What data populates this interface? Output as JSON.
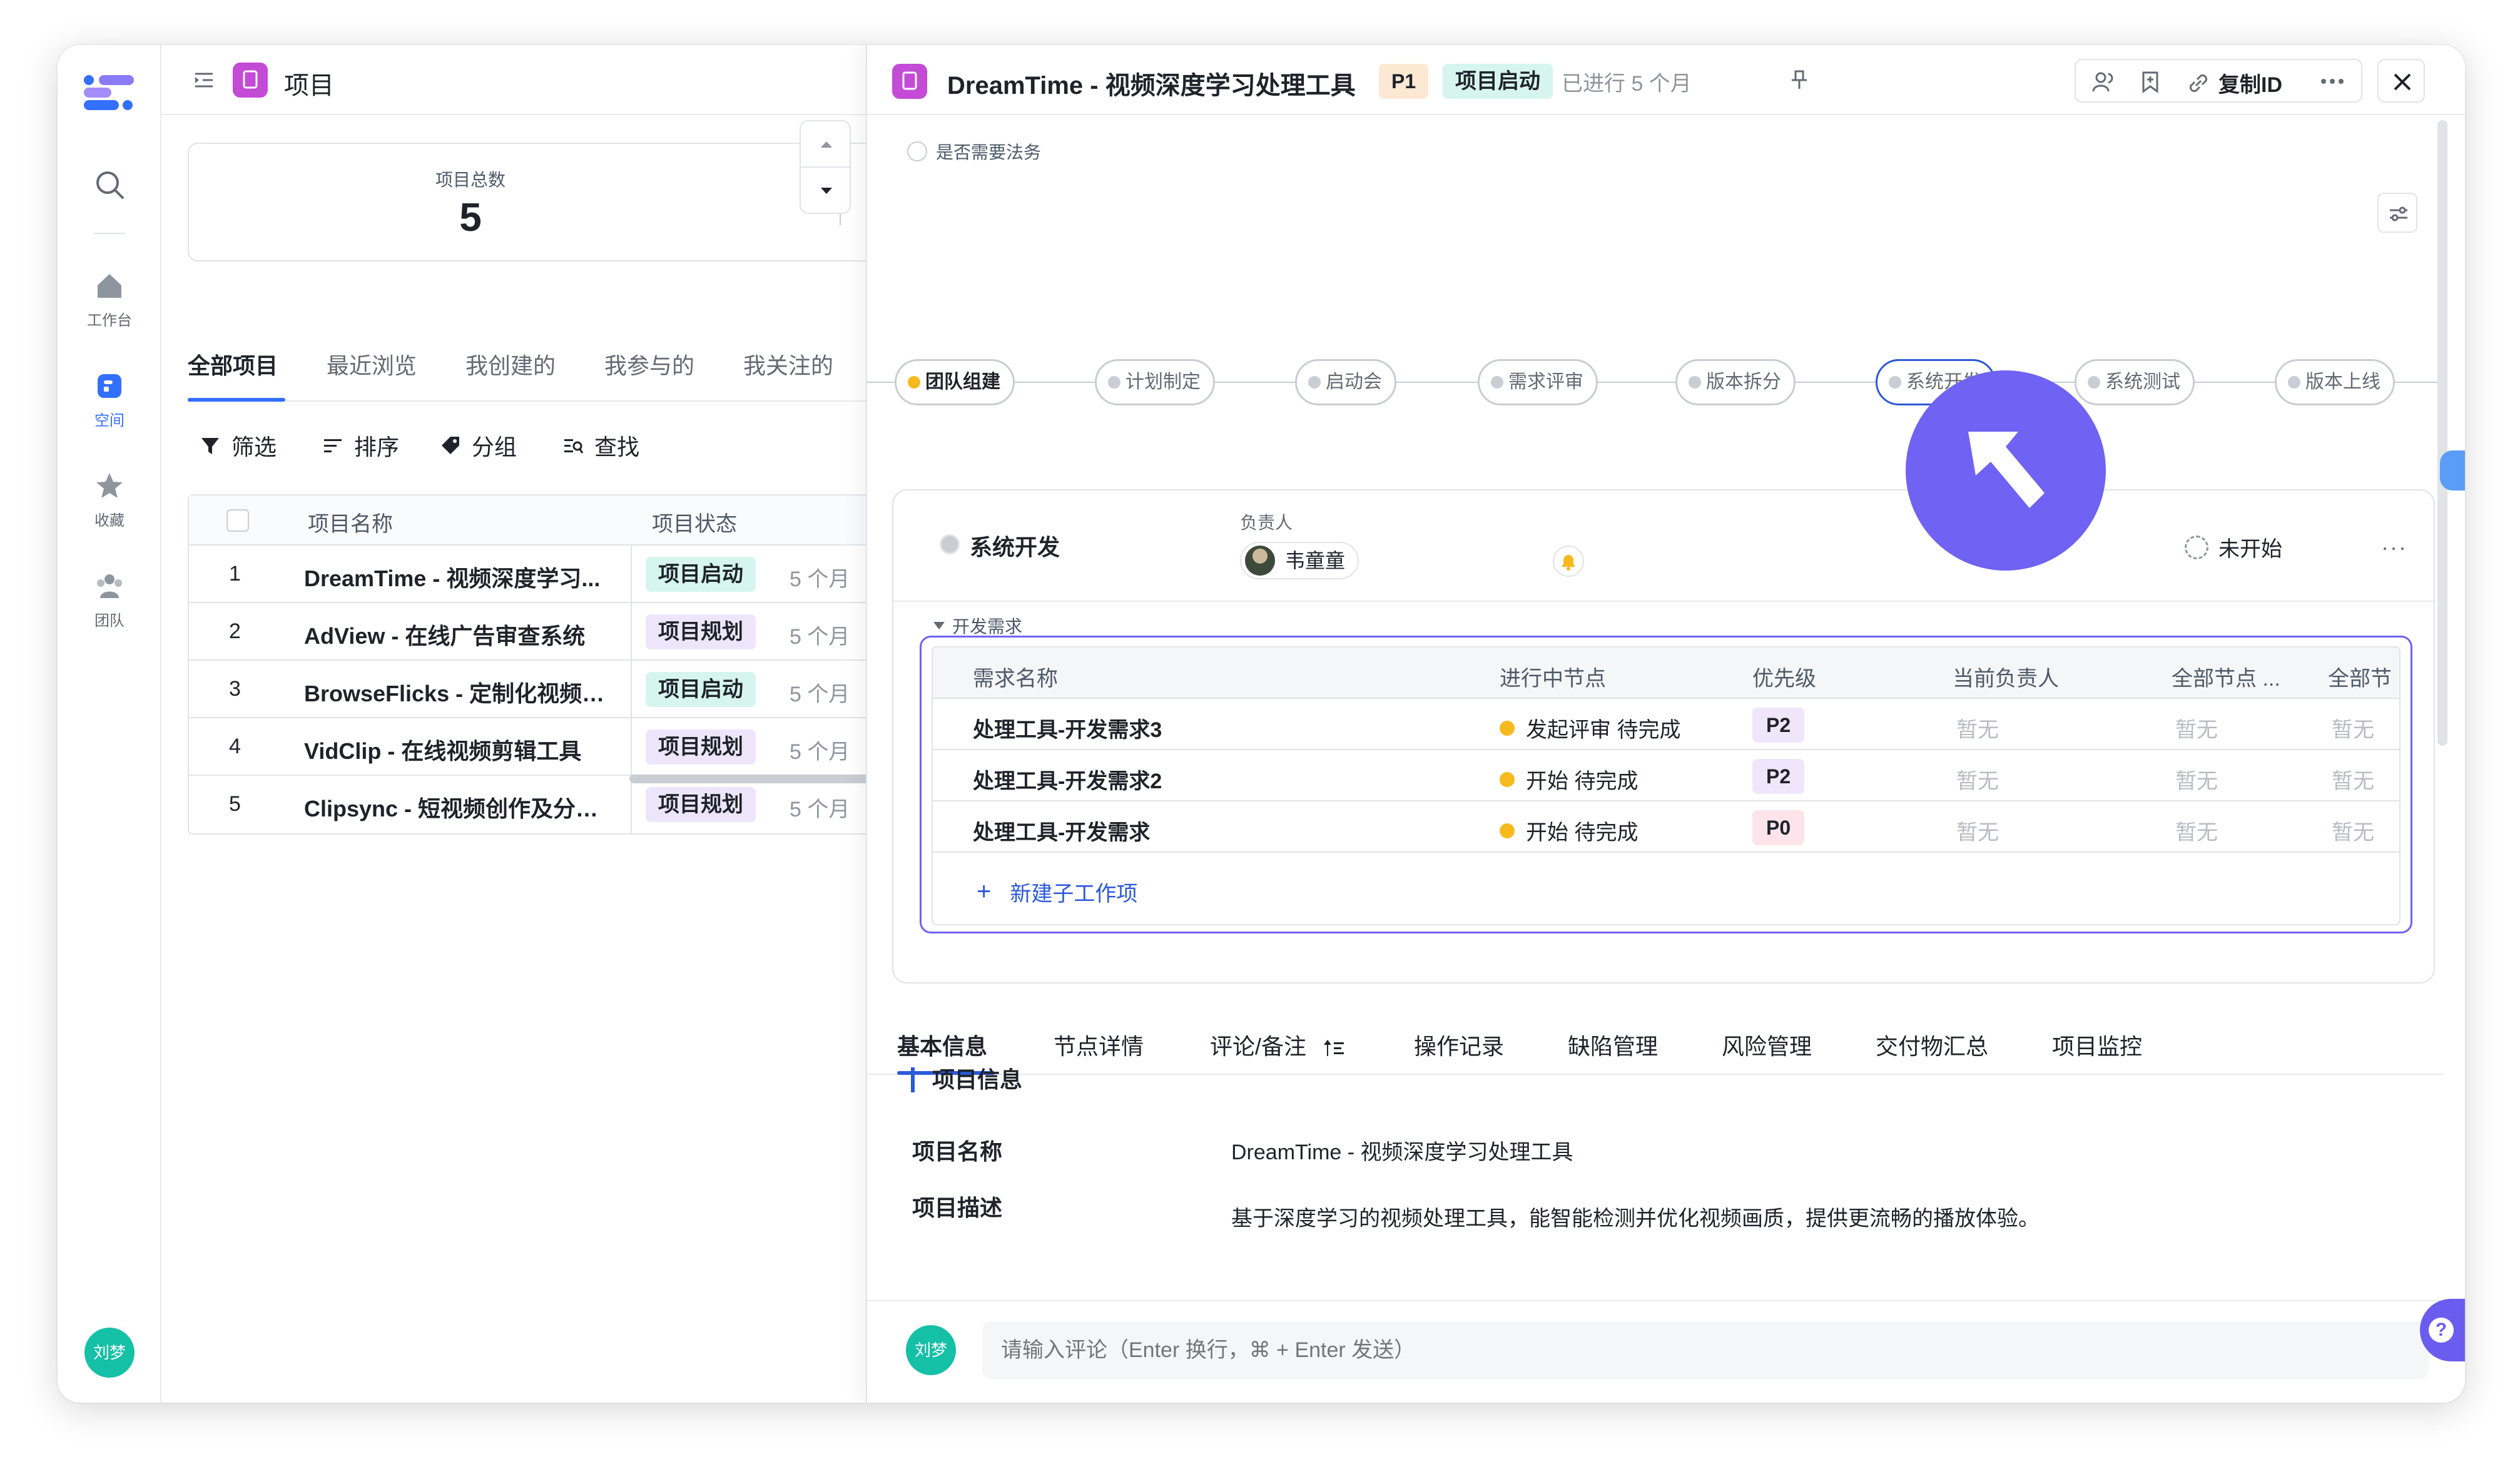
{
  "nav": {
    "items": [
      {
        "label": "工作台",
        "icon": "home-icon"
      },
      {
        "label": "空间",
        "icon": "space-icon",
        "active": true
      },
      {
        "label": "收藏",
        "icon": "star-icon"
      },
      {
        "label": "团队",
        "icon": "team-icon"
      }
    ],
    "user_avatar": "刘梦"
  },
  "list": {
    "title": "项目",
    "stat_label": "项目总数",
    "stat_value": "5",
    "tabs": [
      "全部项目",
      "最近浏览",
      "我创建的",
      "我参与的",
      "我关注的"
    ],
    "toolbar": {
      "filter": "筛选",
      "sort": "排序",
      "group": "分组",
      "find": "查找"
    },
    "columns": {
      "name": "项目名称",
      "status": "项目状态"
    },
    "rows": [
      {
        "index": "1",
        "name": "DreamTime - 视频深度学习...",
        "status": "项目启动",
        "status_color": "#d6f5ef",
        "age": "5 个月"
      },
      {
        "index": "2",
        "name": "AdView - 在线广告审查系统",
        "status": "项目规划",
        "status_color": "#ede6fb",
        "age": "5 个月"
      },
      {
        "index": "3",
        "name": "BrowseFlicks - 定制化视频推...",
        "status": "项目启动",
        "status_color": "#d6f5ef",
        "age": "5 个月"
      },
      {
        "index": "4",
        "name": "VidClip - 在线视频剪辑工具",
        "status": "项目规划",
        "status_color": "#ede6fb",
        "age": "5 个月"
      },
      {
        "index": "5",
        "name": "Clipsync - 短视频创作及分享...",
        "status": "项目规划",
        "status_color": "#ede6fb",
        "age": "5 个月"
      }
    ]
  },
  "detail": {
    "title": "DreamTime - 视频深度学习处理工具",
    "priority": "P1",
    "stage": "项目启动",
    "duration": "已进行 5 个月",
    "copy_id": "复制ID",
    "legal_label": "是否需要法务",
    "flow": [
      {
        "label": "团队组建",
        "state": "done"
      },
      {
        "label": "计划制定",
        "state": "todo"
      },
      {
        "label": "启动会",
        "state": "todo"
      },
      {
        "label": "需求评审",
        "state": "todo"
      },
      {
        "label": "版本拆分",
        "state": "todo"
      },
      {
        "label": "系统开发",
        "state": "current"
      },
      {
        "label": "系统测试",
        "state": "todo"
      },
      {
        "label": "版本上线",
        "state": "todo"
      }
    ],
    "node": {
      "title": "系统开发",
      "owner_label": "负责人",
      "owner": "韦童童",
      "status": "未开始",
      "section": "开发需求",
      "columns": [
        "需求名称",
        "进行中节点",
        "优先级",
        "当前负责人",
        "全部节点 ...",
        "全部节"
      ],
      "rows": [
        {
          "name": "处理工具-开发需求3",
          "stage": "发起评审 待完成",
          "priority": "P2",
          "owner": "暂无",
          "all_nodes": "暂无",
          "all2": "暂无"
        },
        {
          "name": "处理工具-开发需求2",
          "stage": "开始 待完成",
          "priority": "P2",
          "owner": "暂无",
          "all_nodes": "暂无",
          "all2": "暂无"
        },
        {
          "name": "处理工具-开发需求",
          "stage": "开始 待完成",
          "priority": "P0",
          "owner": "暂无",
          "all_nodes": "暂无",
          "all2": "暂无"
        }
      ],
      "new_sub": "新建子工作项"
    },
    "tabs": [
      "基本信息",
      "节点详情",
      "评论/备注",
      "操作记录",
      "缺陷管理",
      "风险管理",
      "交付物汇总",
      "项目监控"
    ],
    "info": {
      "section": "项目信息",
      "name_label": "项目名称",
      "name_value": "DreamTime - 视频深度学习处理工具",
      "desc_label": "项目描述",
      "desc_value": "基于深度学习的视频处理工具，能智能检测并优化视频画质，提供更流畅的播放体验。"
    },
    "comment": {
      "avatar": "刘梦",
      "placeholder": "请输入评论（Enter 换行，⌘ + Enter 发送）"
    }
  }
}
